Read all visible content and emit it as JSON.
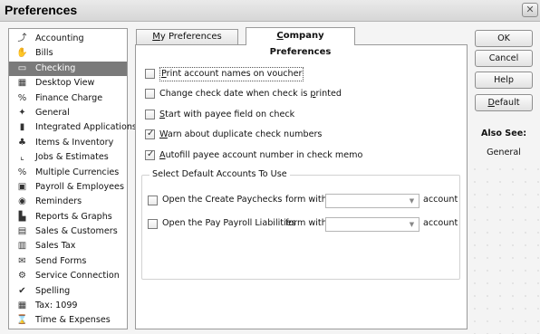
{
  "window": {
    "title": "Preferences",
    "close_glyph": "✕"
  },
  "sidebar": {
    "items": [
      {
        "label": "Accounting",
        "icon": "accounting-icon",
        "glyph": "⤴",
        "selected": false
      },
      {
        "label": "Bills",
        "icon": "bills-icon",
        "glyph": "✋",
        "selected": false
      },
      {
        "label": "Checking",
        "icon": "checking-icon",
        "glyph": "▭",
        "selected": true
      },
      {
        "label": "Desktop View",
        "icon": "desktop-view-icon",
        "glyph": "▦",
        "selected": false
      },
      {
        "label": "Finance Charge",
        "icon": "finance-charge-icon",
        "glyph": "%",
        "selected": false
      },
      {
        "label": "General",
        "icon": "general-icon",
        "glyph": "✦",
        "selected": false
      },
      {
        "label": "Integrated Applications",
        "icon": "integrated-applications-icon",
        "glyph": "▮",
        "selected": false
      },
      {
        "label": "Items & Inventory",
        "icon": "items-inventory-icon",
        "glyph": "♣",
        "selected": false
      },
      {
        "label": "Jobs & Estimates",
        "icon": "jobs-estimates-icon",
        "glyph": "⌞",
        "selected": false
      },
      {
        "label": "Multiple Currencies",
        "icon": "multiple-currencies-icon",
        "glyph": "%",
        "selected": false
      },
      {
        "label": "Payroll & Employees",
        "icon": "payroll-employees-icon",
        "glyph": "▣",
        "selected": false
      },
      {
        "label": "Reminders",
        "icon": "reminders-icon",
        "glyph": "◉",
        "selected": false
      },
      {
        "label": "Reports & Graphs",
        "icon": "reports-graphs-icon",
        "glyph": "▙",
        "selected": false
      },
      {
        "label": "Sales & Customers",
        "icon": "sales-customers-icon",
        "glyph": "▤",
        "selected": false
      },
      {
        "label": "Sales Tax",
        "icon": "sales-tax-icon",
        "glyph": "▥",
        "selected": false
      },
      {
        "label": "Send Forms",
        "icon": "send-forms-icon",
        "glyph": "✉",
        "selected": false
      },
      {
        "label": "Service Connection",
        "icon": "service-connection-icon",
        "glyph": "⚙",
        "selected": false
      },
      {
        "label": "Spelling",
        "icon": "spelling-icon",
        "glyph": "✔",
        "selected": false
      },
      {
        "label": "Tax: 1099",
        "icon": "tax-1099-icon",
        "glyph": "▦",
        "selected": false
      },
      {
        "label": "Time & Expenses",
        "icon": "time-expenses-icon",
        "glyph": "⌛",
        "selected": false
      }
    ]
  },
  "tabs": {
    "my_pre": "",
    "my_ul": "M",
    "my_post": "y Preferences",
    "company_pre": "",
    "company_ul": "C",
    "company_post": "ompany Preferences"
  },
  "options": {
    "print_names": {
      "pre": "",
      "ul": "P",
      "post": "rint account names on voucher",
      "checked": false
    },
    "change_date": {
      "pre": "Change check date when check is ",
      "ul": "p",
      "post": "rinted",
      "checked": false
    },
    "start_payee": {
      "pre": "",
      "ul": "S",
      "post": "tart with payee field on check",
      "checked": false
    },
    "warn_dup": {
      "pre": "",
      "ul": "W",
      "post": "arn about duplicate check numbers",
      "checked": true
    },
    "autofill": {
      "pre": "",
      "ul": "A",
      "post": "utofill payee account number in check memo",
      "checked": true
    }
  },
  "default_accounts": {
    "title": "Select Default Accounts To Use",
    "rows": [
      {
        "label": "Open the Create Paychecks",
        "form_with": "form with",
        "value": "",
        "account": "account"
      },
      {
        "label": "Open the Pay Payroll Liabilities",
        "form_with": "form with",
        "value": "",
        "account": "account"
      }
    ]
  },
  "buttons": {
    "ok": "OK",
    "cancel": "Cancel",
    "help": "Help",
    "default_pre": "",
    "default_ul": "D",
    "default_post": "efault"
  },
  "also_see": {
    "title": "Also See:",
    "link": "General"
  }
}
